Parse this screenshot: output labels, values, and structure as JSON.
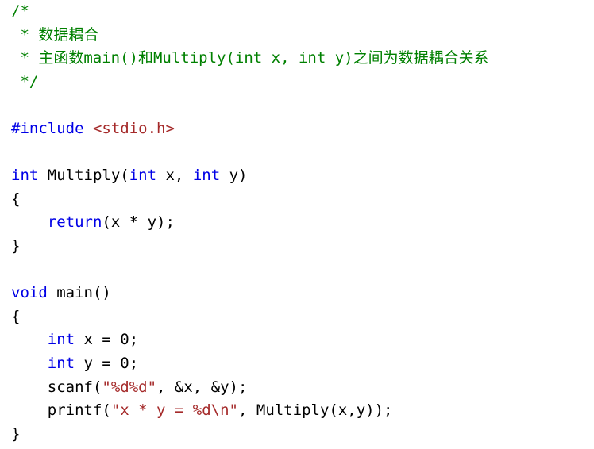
{
  "editor": {
    "language": "c",
    "background_color": "#ffffff",
    "font_size_px": 19,
    "line_height_px": 29.6,
    "indent": "    "
  },
  "theme": {
    "comment_color": "#008000",
    "keyword_color": "#0000e6",
    "string_color": "#a52a2a",
    "preprocessor_color": "#0000e6",
    "plain_color": "#000000"
  },
  "code": {
    "lines": [
      {
        "number": 1,
        "text": "/*",
        "tokens": [
          {
            "t": "/*",
            "k": "comment"
          }
        ]
      },
      {
        "number": 2,
        "text": " * 数据耦合",
        "tokens": [
          {
            "t": " * 数据耦合",
            "k": "comment"
          }
        ]
      },
      {
        "number": 3,
        "text": " * 主函数main()和Multiply(int x, int y)之间为数据耦合关系",
        "tokens": [
          {
            "t": " * 主函数main()和Multiply(int x, int y)之间为数据耦合关系",
            "k": "comment"
          }
        ]
      },
      {
        "number": 4,
        "text": " */",
        "tokens": [
          {
            "t": " */",
            "k": "comment"
          }
        ]
      },
      {
        "number": 5,
        "text": "",
        "tokens": []
      },
      {
        "number": 6,
        "text": "#include <stdio.h>",
        "tokens": [
          {
            "t": "#include",
            "k": "preproc"
          },
          {
            "t": " ",
            "k": "plain"
          },
          {
            "t": "<stdio.h>",
            "k": "string"
          }
        ]
      },
      {
        "number": 7,
        "text": "",
        "tokens": []
      },
      {
        "number": 8,
        "text": "int Multiply(int x, int y)",
        "tokens": [
          {
            "t": "int",
            "k": "keyword"
          },
          {
            "t": " Multiply(",
            "k": "plain"
          },
          {
            "t": "int",
            "k": "keyword"
          },
          {
            "t": " x, ",
            "k": "plain"
          },
          {
            "t": "int",
            "k": "keyword"
          },
          {
            "t": " y)",
            "k": "plain"
          }
        ]
      },
      {
        "number": 9,
        "text": "{",
        "tokens": [
          {
            "t": "{",
            "k": "plain"
          }
        ]
      },
      {
        "number": 10,
        "text": "    return(x * y);",
        "tokens": [
          {
            "t": "    ",
            "k": "plain"
          },
          {
            "t": "return",
            "k": "keyword"
          },
          {
            "t": "(x * y);",
            "k": "plain"
          }
        ]
      },
      {
        "number": 11,
        "text": "}",
        "tokens": [
          {
            "t": "}",
            "k": "plain"
          }
        ]
      },
      {
        "number": 12,
        "text": "",
        "tokens": []
      },
      {
        "number": 13,
        "text": "void main()",
        "tokens": [
          {
            "t": "void",
            "k": "keyword"
          },
          {
            "t": " main()",
            "k": "plain"
          }
        ]
      },
      {
        "number": 14,
        "text": "{",
        "tokens": [
          {
            "t": "{",
            "k": "plain"
          }
        ]
      },
      {
        "number": 15,
        "text": "    int x = 0;",
        "tokens": [
          {
            "t": "    ",
            "k": "plain"
          },
          {
            "t": "int",
            "k": "keyword"
          },
          {
            "t": " x = 0;",
            "k": "plain"
          }
        ]
      },
      {
        "number": 16,
        "text": "    int y = 0;",
        "tokens": [
          {
            "t": "    ",
            "k": "plain"
          },
          {
            "t": "int",
            "k": "keyword"
          },
          {
            "t": " y = 0;",
            "k": "plain"
          }
        ]
      },
      {
        "number": 17,
        "text": "    scanf(\"%d%d\", &x, &y);",
        "tokens": [
          {
            "t": "    scanf(",
            "k": "plain"
          },
          {
            "t": "\"%d%d\"",
            "k": "string"
          },
          {
            "t": ", &x, &y);",
            "k": "plain"
          }
        ]
      },
      {
        "number": 18,
        "text": "    printf(\"x * y = %d\\n\", Multiply(x,y));",
        "tokens": [
          {
            "t": "    printf(",
            "k": "plain"
          },
          {
            "t": "\"x * y = %d\\n\"",
            "k": "string"
          },
          {
            "t": ", Multiply(x,y));",
            "k": "plain"
          }
        ]
      },
      {
        "number": 19,
        "text": "}",
        "tokens": [
          {
            "t": "}",
            "k": "plain"
          }
        ]
      }
    ]
  }
}
